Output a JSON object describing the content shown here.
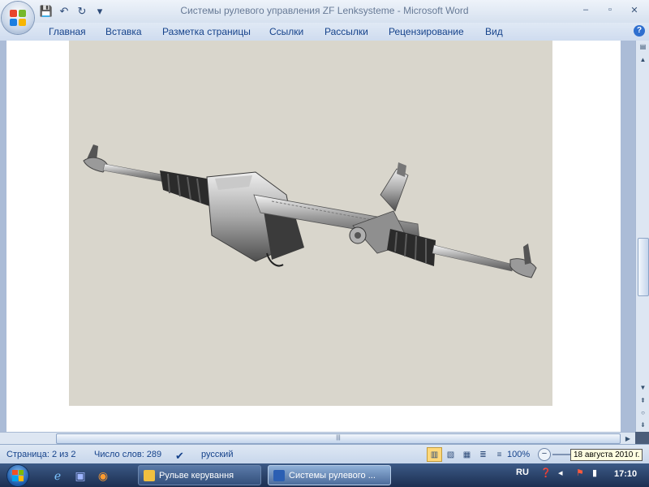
{
  "window": {
    "title": "Системы рулевого управления ZF Lenksysteme - Microsoft Word",
    "controls": {
      "minimize": "–",
      "maximize": "▫",
      "close": "✕"
    }
  },
  "quick_access": [
    {
      "icon": "save-icon",
      "glyph": "💾"
    },
    {
      "icon": "undo-icon",
      "glyph": "↶"
    },
    {
      "icon": "redo-icon",
      "glyph": "↻"
    },
    {
      "icon": "customize-qat-icon",
      "glyph": "▾"
    }
  ],
  "ribbon": {
    "tabs": [
      "Главная",
      "Вставка",
      "Разметка страницы",
      "Ссылки",
      "Рассылки",
      "Рецензирование",
      "Вид"
    ],
    "help": "?"
  },
  "colors": {
    "office_logo": [
      "#e8442b",
      "#76b82a",
      "#1c7ee0",
      "#f7b500"
    ],
    "picture_bg": "#d9d6cc",
    "ribbon_text": "#15428b"
  },
  "document": {
    "image": "steering-rack-illustration"
  },
  "scrollbars": {
    "vertical_icons": [
      "scroll-up-icon",
      "ruler-icon",
      "scroll-down-icon",
      "prev-page-icon",
      "browse-object-icon",
      "next-page-icon"
    ],
    "grip": "|||"
  },
  "status": {
    "page": "Страница: 2 из 2",
    "words": "Число слов: 289",
    "language": "русский",
    "zoom": "100%",
    "zoom_minus": "−"
  },
  "tooltip": "18 августа 2010 г.",
  "taskbar": {
    "buttons": [
      {
        "label": "Рульве керування",
        "active": false,
        "icon_color": "#f0c040"
      },
      {
        "label": "Системы рулевого ...",
        "active": true,
        "icon_color": "#2b5fb3"
      }
    ],
    "tray": {
      "language": "RU",
      "time": "17:10"
    }
  }
}
